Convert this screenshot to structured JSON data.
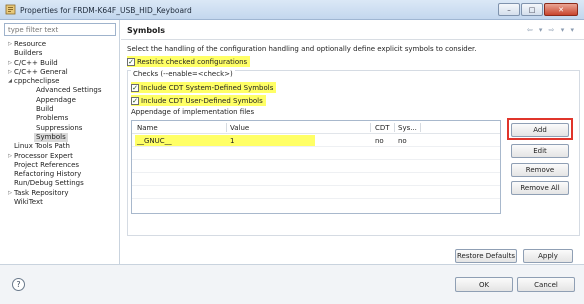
{
  "window": {
    "title": "Properties for FRDM-K64F_USB_HID_Keyboard",
    "minimize_glyph": "–",
    "maximize_glyph": "□",
    "close_glyph": "✕"
  },
  "sidebar": {
    "filter_placeholder": "type filter text",
    "items": [
      {
        "label": "Resource",
        "twisty": "▷"
      },
      {
        "label": "Builders",
        "twisty": ""
      },
      {
        "label": "C/C++ Build",
        "twisty": "▷"
      },
      {
        "label": "C/C++ General",
        "twisty": "▷"
      },
      {
        "label": "cppcheclipse",
        "twisty": "◢"
      },
      {
        "label": "Advanced Settings",
        "twisty": ""
      },
      {
        "label": "Appendage",
        "twisty": ""
      },
      {
        "label": "Build",
        "twisty": ""
      },
      {
        "label": "Problems",
        "twisty": ""
      },
      {
        "label": "Suppressions",
        "twisty": ""
      },
      {
        "label": "Symbols",
        "twisty": ""
      },
      {
        "label": "Linux Tools Path",
        "twisty": ""
      },
      {
        "label": "Processor Expert",
        "twisty": "▷"
      },
      {
        "label": "Project References",
        "twisty": ""
      },
      {
        "label": "Refactoring History",
        "twisty": ""
      },
      {
        "label": "Run/Debug Settings",
        "twisty": ""
      },
      {
        "label": "Task Repository",
        "twisty": "▷"
      },
      {
        "label": "WikiText",
        "twisty": ""
      }
    ]
  },
  "header": {
    "title": "Symbols",
    "nav": "⇦ ▾ ⇨ ▾ ▾"
  },
  "main": {
    "description": "Select the handling of the configuration handling and optionally define explicit symbols to consider.",
    "restrict_label": "Restrict checked configurations",
    "checks_label": "Checks (--enable=<check>)",
    "include_system_label": "Include CDT System-Defined Symbols",
    "include_user_label": "Include CDT User-Defined Symbols",
    "appendage_label": "Appendage of implementation files",
    "check_glyph": "✓",
    "table": {
      "columns": [
        "Name",
        "Value",
        "CDT",
        "Sys..."
      ],
      "rows": [
        {
          "name": "__GNUC__",
          "value": "1",
          "cdt": "no",
          "sys": "no"
        }
      ]
    },
    "buttons": {
      "add": "Add",
      "edit": "Edit",
      "remove": "Remove",
      "remove_all": "Remove All",
      "restore_defaults": "Restore Defaults",
      "apply": "Apply"
    }
  },
  "footer": {
    "help_glyph": "?",
    "ok": "OK",
    "cancel": "Cancel"
  },
  "colors": {
    "highlight": "#ffff66",
    "red_outline": "#e0352b",
    "title_gradient_top": "#dbe8f6"
  }
}
